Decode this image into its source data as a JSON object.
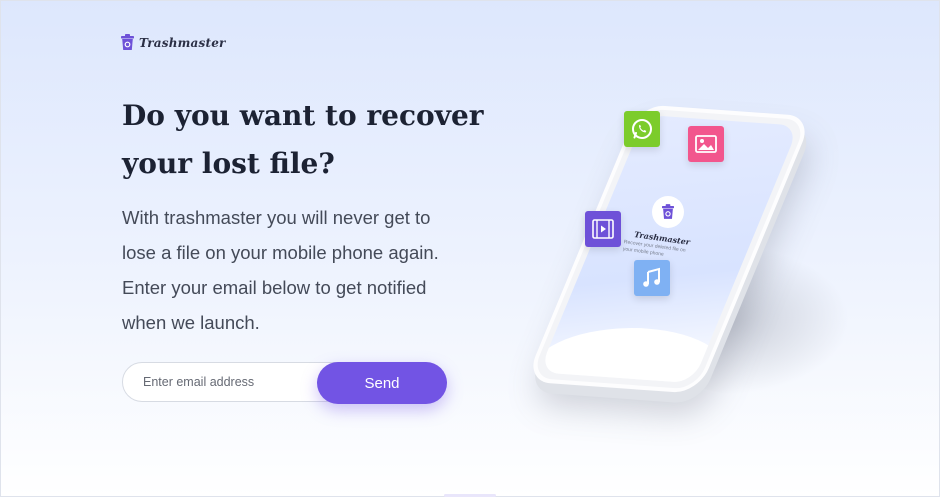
{
  "brand": {
    "name": "Trashmaster"
  },
  "hero": {
    "headline": "Do you want to recover your lost file?",
    "description": "With trashmaster you will never get to lose a file on your mobile phone again. Enter your email below to get notified when we launch."
  },
  "form": {
    "email_placeholder": "Enter email address",
    "send_label": "Send"
  },
  "illustration": {
    "screen_title": "Trashmaster",
    "screen_caption": "Recover your deleted file on your mobile phone",
    "icons": [
      "whatsapp-icon",
      "gallery-icon",
      "video-icon",
      "music-icon"
    ]
  },
  "colors": {
    "accent": "#7254e4",
    "whatsapp": "#7ccc2b",
    "gallery": "#f2568d",
    "video": "#6e51d8",
    "music": "#7fb1f3"
  }
}
